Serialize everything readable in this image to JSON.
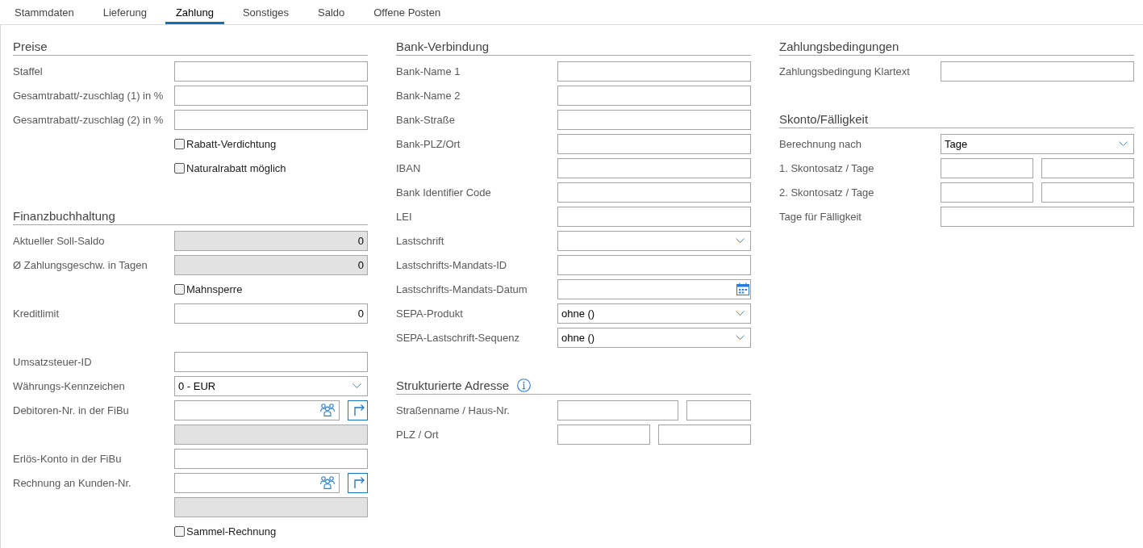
{
  "tabs": [
    {
      "label": "Stammdaten",
      "selected": false
    },
    {
      "label": "Lieferung",
      "selected": false
    },
    {
      "label": "Zahlung",
      "selected": true
    },
    {
      "label": "Sonstiges",
      "selected": false
    },
    {
      "label": "Saldo",
      "selected": false
    },
    {
      "label": "Offene Posten",
      "selected": false
    }
  ],
  "columns": [
    {
      "sections": [
        {
          "title": "Preise",
          "info": false,
          "groups": [
            [
              {
                "kind": "text",
                "label": "Staffel",
                "readonly": false
              },
              {
                "kind": "text",
                "label": "Gesamtrabatt/-zuschlag (1) in %",
                "readonly": false
              },
              {
                "kind": "text",
                "label": "Gesamtrabatt/-zuschlag (2) in %",
                "readonly": false
              },
              {
                "kind": "checkbox",
                "label": "Rabatt-Verdichtung",
                "checked": false
              },
              {
                "kind": "checkbox",
                "label": "Naturalrabatt möglich",
                "checked": false
              }
            ]
          ]
        },
        {
          "title": "Finanzbuchhaltung",
          "info": false,
          "groups": [
            [
              {
                "kind": "number",
                "label": "Aktueller Soll-Saldo",
                "value": "0",
                "readonly": true
              },
              {
                "kind": "number",
                "label": "Ø Zahlungsgeschw. in Tagen",
                "value": "0",
                "readonly": true
              },
              {
                "kind": "checkbox",
                "label": "Mahnsperre",
                "checked": false
              },
              {
                "kind": "number",
                "label": "Kreditlimit",
                "value": "0",
                "readonly": false
              }
            ],
            [
              {
                "kind": "text",
                "label": "Umsatzsteuer-ID",
                "readonly": false
              },
              {
                "kind": "select",
                "label": "Währungs-Kennzeichen",
                "value": "0 - EUR"
              },
              {
                "kind": "lookup",
                "label": "Debitoren-Nr. in der FiBu"
              },
              {
                "kind": "text",
                "readonly": true
              },
              {
                "kind": "text",
                "label": "Erlös-Konto in der FiBu",
                "readonly": false
              },
              {
                "kind": "lookup",
                "label": "Rechnung an Kunden-Nr."
              },
              {
                "kind": "text",
                "readonly": true
              },
              {
                "kind": "checkbox",
                "label": "Sammel-Rechnung",
                "checked": false
              }
            ]
          ]
        }
      ]
    },
    {
      "sections": [
        {
          "title": "Bank-Verbindung",
          "info": false,
          "groups": [
            [
              {
                "kind": "text",
                "label": "Bank-Name 1",
                "readonly": false
              },
              {
                "kind": "text",
                "label": "Bank-Name 2",
                "readonly": false
              },
              {
                "kind": "text",
                "label": "Bank-Straße",
                "readonly": false
              },
              {
                "kind": "text",
                "label": "Bank-PLZ/Ort",
                "readonly": false
              },
              {
                "kind": "text",
                "label": "IBAN",
                "readonly": false
              },
              {
                "kind": "text",
                "label": "Bank Identifier Code",
                "readonly": false
              },
              {
                "kind": "text",
                "label": "LEI",
                "readonly": false
              },
              {
                "kind": "select",
                "label": "Lastschrift"
              },
              {
                "kind": "text",
                "label": "Lastschrifts-Mandats-ID",
                "readonly": false
              },
              {
                "kind": "date",
                "label": "Lastschrifts-Mandats-Datum"
              },
              {
                "kind": "select",
                "label": "SEPA-Produkt",
                "value": "ohne ()"
              },
              {
                "kind": "select",
                "label": "SEPA-Lastschrift-Sequenz",
                "value": "ohne ()"
              }
            ]
          ]
        },
        {
          "title": "Strukturierte Adresse",
          "info": true,
          "groups": [
            [
              {
                "kind": "street",
                "label": "Straßenname / Haus-Nr."
              },
              {
                "kind": "pair",
                "label": "PLZ / Ort"
              }
            ]
          ]
        }
      ]
    },
    {
      "sections": [
        {
          "title": "Zahlungsbedingungen",
          "info": false,
          "groups": [
            [
              {
                "kind": "text",
                "label": "Zahlungsbedingung Klartext",
                "readonly": false
              }
            ]
          ]
        },
        {
          "title": "Skonto/Fälligkeit",
          "info": false,
          "groups": [
            [
              {
                "kind": "select",
                "label": "Berechnung nach",
                "value": "Tage"
              },
              {
                "kind": "pair",
                "label": "1. Skontosatz / Tage"
              },
              {
                "kind": "pair",
                "label": "2. Skontosatz / Tage"
              },
              {
                "kind": "text",
                "label": "Tage für Fälligkeit",
                "readonly": false
              }
            ]
          ]
        }
      ]
    }
  ]
}
